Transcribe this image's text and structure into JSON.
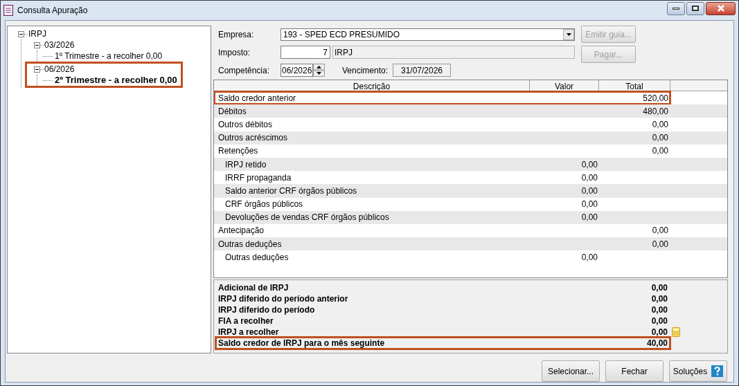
{
  "window": {
    "title": "Consulta Apuração"
  },
  "tree": [
    {
      "label": "IRPJ",
      "expanded": true,
      "selected": false,
      "highlighted": false,
      "children": [
        {
          "label": "03/2026",
          "expanded": true,
          "selected": false,
          "highlighted": false,
          "children": [
            {
              "label": "1º Trimestre - a recolher 0,00",
              "selected": false,
              "highlighted": false
            }
          ]
        },
        {
          "label": "06/2026",
          "expanded": true,
          "selected": false,
          "highlighted": true,
          "children": [
            {
              "label": "2º Trimestre - a recolher 0,00",
              "selected": true,
              "highlighted": false
            }
          ]
        }
      ]
    }
  ],
  "form": {
    "empresa": {
      "label": "Empresa:",
      "value": "193 - SPED ECD PRESUMIDO"
    },
    "imposto": {
      "label": "Imposto:",
      "code": "7",
      "name": "IRPJ"
    },
    "competencia": {
      "label": "Competência:",
      "value": "06/2026"
    },
    "vencimento": {
      "label": "Vencimento:",
      "value": "31/07/2026"
    }
  },
  "side_buttons": [
    {
      "label": "Emitir guia...",
      "disabled": true
    },
    {
      "label": "Pagar...",
      "disabled": true
    }
  ],
  "grid": {
    "columns": [
      "Descrição",
      "Valor",
      "Total"
    ],
    "rows": [
      {
        "kind": "total",
        "description": "Saldo credor anterior",
        "value": "520,00",
        "highlighted": true
      },
      {
        "kind": "total",
        "description": "Débitos",
        "value": "480,00",
        "highlighted": false
      },
      {
        "kind": "total",
        "description": "Outros débitos",
        "value": "0,00",
        "highlighted": false
      },
      {
        "kind": "total",
        "description": "Outros acréscimos",
        "value": "0,00",
        "highlighted": false
      },
      {
        "kind": "total",
        "description": "Retenções",
        "value": "0,00",
        "highlighted": false
      },
      {
        "kind": "detail",
        "description": "IRPJ retido",
        "value": "0,00",
        "highlighted": false
      },
      {
        "kind": "detail",
        "description": "IRRF propaganda",
        "value": "0,00",
        "highlighted": false
      },
      {
        "kind": "detail",
        "description": "Saldo anterior CRF órgãos públicos",
        "value": "0,00",
        "highlighted": false
      },
      {
        "kind": "detail",
        "description": "CRF órgãos públicos",
        "value": "0,00",
        "highlighted": false
      },
      {
        "kind": "detail",
        "description": "Devoluções de vendas CRF órgãos públicos",
        "value": "0,00",
        "highlighted": false
      },
      {
        "kind": "total",
        "description": "Antecipação",
        "value": "0,00",
        "highlighted": false
      },
      {
        "kind": "total",
        "description": "Outras deduções",
        "value": "0,00",
        "highlighted": false
      },
      {
        "kind": "detail",
        "description": "Outras deduções",
        "value": "0,00",
        "highlighted": false
      }
    ]
  },
  "summary": [
    {
      "label": "Adicional de IRPJ",
      "value": "0,00",
      "highlighted": false,
      "calculator": false
    },
    {
      "label": "IRPJ diferido do período anterior",
      "value": "0,00",
      "highlighted": false,
      "calculator": false
    },
    {
      "label": "IRPJ diferido do período",
      "value": "0,00",
      "highlighted": false,
      "calculator": false
    },
    {
      "label": "FIA a recolher",
      "value": "0,00",
      "highlighted": false,
      "calculator": false
    },
    {
      "label": "IRPJ a recolher",
      "value": "0,00",
      "highlighted": false,
      "calculator": true
    },
    {
      "label": "Saldo credor de IRPJ para o mês seguinte",
      "value": "40,00",
      "highlighted": true,
      "calculator": false
    }
  ],
  "footer_buttons": [
    {
      "kind": "plain",
      "label": "Selecionar..."
    },
    {
      "kind": "plain",
      "label": "Fechar"
    },
    {
      "kind": "help",
      "label": "Soluções"
    }
  ]
}
